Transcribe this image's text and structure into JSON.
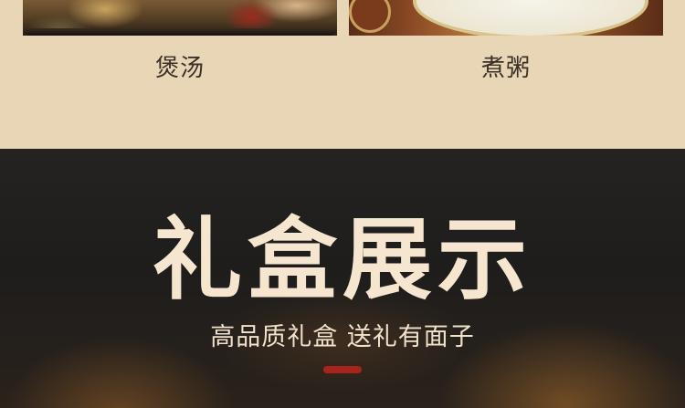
{
  "section_top": {
    "items": [
      {
        "label": "煲汤"
      },
      {
        "label": "煮粥"
      }
    ]
  },
  "section_gift": {
    "title": "礼盒展示",
    "subtitle": "高品质礼盒 送礼有面子"
  },
  "colors": {
    "beige_background": "#e9d6b6",
    "dark_background": "#232221",
    "title_text": "#f7e6cf",
    "accent": "#a8231c"
  }
}
